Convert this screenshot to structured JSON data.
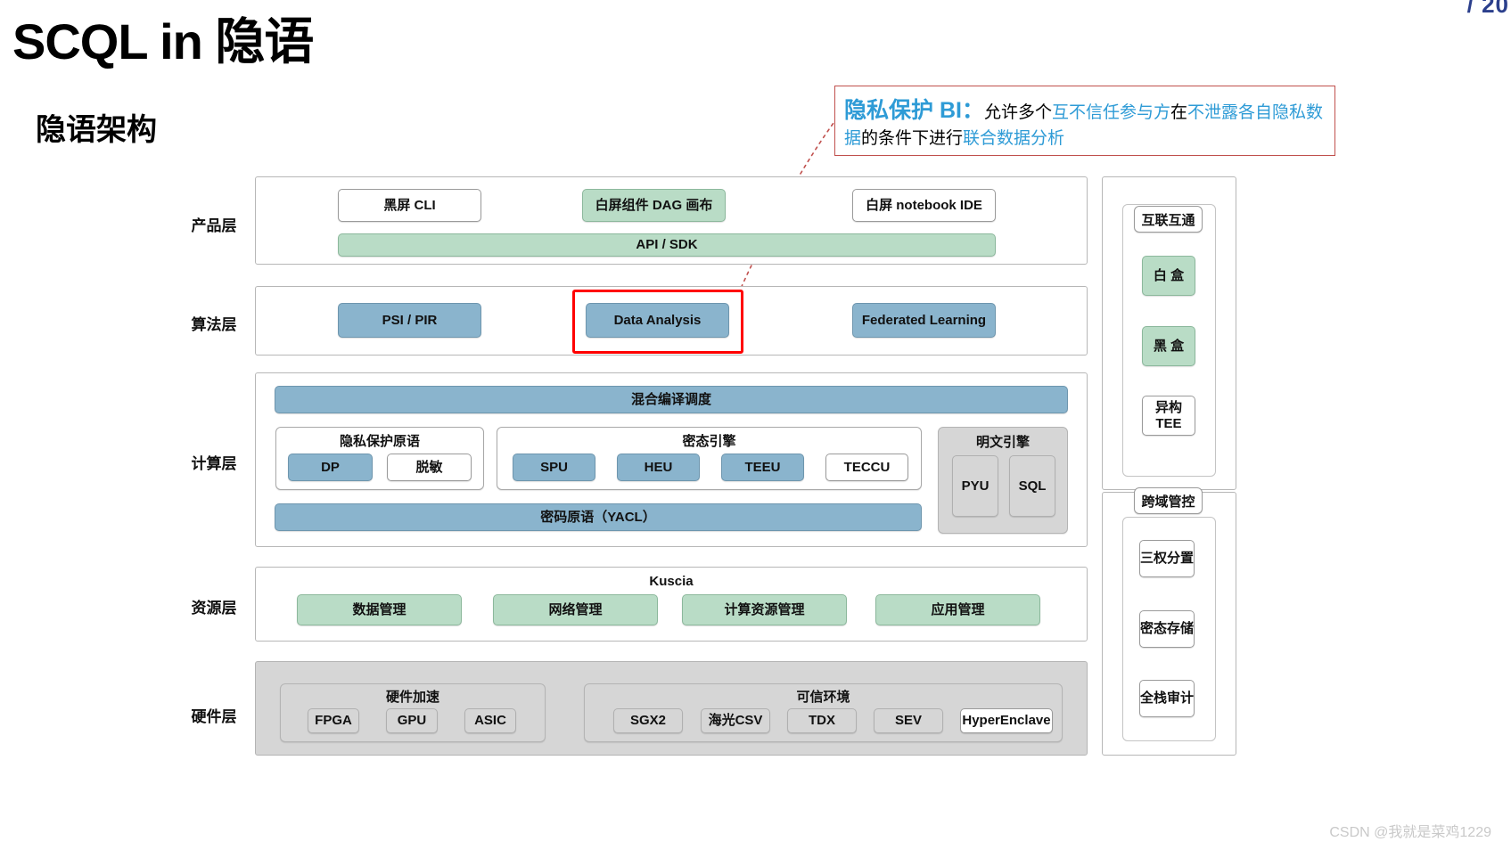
{
  "header": {
    "title": "SCQL in 隐语",
    "subtitle": "隐语架构",
    "corner_logo": "/ 20",
    "watermark": "CSDN @我就是菜鸡1229"
  },
  "callout": {
    "head": "隐私保护 BI：",
    "seg1": "允许多个",
    "seg2": "互不信任参与方",
    "seg3": "在",
    "seg4": "不泄露各自隐私数据",
    "seg5": "的条件下进行",
    "seg6": "联合数据分析",
    "border_color": "#c0504d",
    "accent_color": "#2e9bd6"
  },
  "layers": {
    "product": {
      "label": "产品层",
      "nodes": [
        {
          "label": "黑屏 CLI",
          "style": "white"
        },
        {
          "label": "白屏组件 DAG 画布",
          "style": "green"
        },
        {
          "label": "白屏 notebook IDE",
          "style": "white"
        }
      ],
      "bar": {
        "label": "API / SDK",
        "style": "green"
      }
    },
    "algorithm": {
      "label": "算法层",
      "nodes": [
        {
          "label": "PSI / PIR",
          "style": "blue"
        },
        {
          "label": "Data Analysis",
          "style": "blue",
          "highlighted": true
        },
        {
          "label": "Federated Learning",
          "style": "blue"
        }
      ]
    },
    "compute": {
      "label": "计算层",
      "top_bar": {
        "label": "混合编译调度",
        "style": "blue"
      },
      "bottom_bar": {
        "label": "密码原语（YACL）",
        "style": "blue"
      },
      "groups": [
        {
          "title": "隐私保护原语",
          "nodes": [
            {
              "label": "DP",
              "style": "blue"
            },
            {
              "label": "脱敏",
              "style": "white"
            }
          ]
        },
        {
          "title": "密态引擎",
          "nodes": [
            {
              "label": "SPU",
              "style": "blue"
            },
            {
              "label": "HEU",
              "style": "blue"
            },
            {
              "label": "TEEU",
              "style": "blue"
            },
            {
              "label": "TECCU",
              "style": "white"
            }
          ]
        },
        {
          "title": "明文引擎",
          "grey_panel": true,
          "nodes": [
            {
              "label": "PYU",
              "style": "grey"
            },
            {
              "label": "SQL",
              "style": "grey"
            }
          ]
        }
      ]
    },
    "resource": {
      "label": "资源层",
      "title": "Kuscia",
      "nodes": [
        {
          "label": "数据管理",
          "style": "green"
        },
        {
          "label": "网络管理",
          "style": "green"
        },
        {
          "label": "计算资源管理",
          "style": "green"
        },
        {
          "label": "应用管理",
          "style": "green"
        }
      ]
    },
    "hardware": {
      "label": "硬件层",
      "groups": [
        {
          "title": "硬件加速",
          "nodes": [
            {
              "label": "FPGA",
              "style": "grey"
            },
            {
              "label": "GPU",
              "style": "grey"
            },
            {
              "label": "ASIC",
              "style": "grey"
            }
          ]
        },
        {
          "title": "可信环境",
          "nodes": [
            {
              "label": "SGX2",
              "style": "grey"
            },
            {
              "label": "海光CSV",
              "style": "grey"
            },
            {
              "label": "TDX",
              "style": "grey"
            },
            {
              "label": "SEV",
              "style": "grey"
            },
            {
              "label": "HyperEnclave",
              "style": "white"
            }
          ]
        }
      ]
    }
  },
  "side_panels": [
    {
      "head": "互联互通",
      "nodes": [
        {
          "label": "白 盒",
          "style": "green"
        },
        {
          "label": "黑 盒",
          "style": "green"
        },
        {
          "label": "异构\nTEE",
          "style": "white"
        }
      ]
    },
    {
      "head": "跨域管控",
      "nodes": [
        {
          "label": "三权分置",
          "style": "white"
        },
        {
          "label": "密态存储",
          "style": "white"
        },
        {
          "label": "全栈审计",
          "style": "white"
        }
      ]
    }
  ]
}
